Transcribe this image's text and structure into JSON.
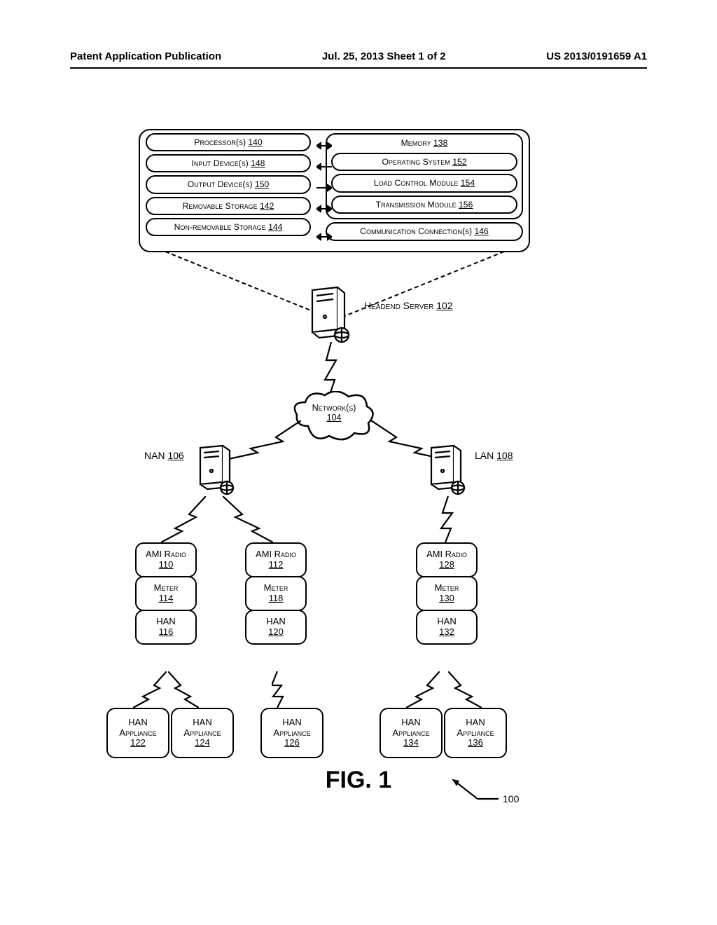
{
  "header": {
    "left": "Patent Application Publication",
    "center": "Jul. 25, 2013  Sheet 1 of 2",
    "right": "US 2013/0191659 A1"
  },
  "headend": {
    "processors": {
      "label": "Processor(s)",
      "ref": "140"
    },
    "input_devices": {
      "label": "Input Device(s)",
      "ref": "148"
    },
    "output_devices": {
      "label": "Output Device(s)",
      "ref": "150"
    },
    "removable_storage": {
      "label": "Removable Storage",
      "ref": "142"
    },
    "nonremovable_storage": {
      "label": "Non-removable Storage",
      "ref": "144"
    },
    "memory": {
      "label": "Memory",
      "ref": "138"
    },
    "os": {
      "label": "Operating System",
      "ref": "152"
    },
    "load_control": {
      "label": "Load Control Module",
      "ref": "154"
    },
    "transmission": {
      "label": "Transmission Module",
      "ref": "156"
    },
    "comm": {
      "label": "Communication Connection(s)",
      "ref": "146"
    }
  },
  "server_label": {
    "label": "Headend Server",
    "ref": "102"
  },
  "network": {
    "label": "Network(s)",
    "ref": "104"
  },
  "nan": {
    "label": "NAN",
    "ref": "106"
  },
  "lan": {
    "label": "LAN",
    "ref": "108"
  },
  "stacks": {
    "nan_left": {
      "ami": {
        "label": "AMI Radio",
        "ref": "110"
      },
      "meter": {
        "label": "Meter",
        "ref": "114"
      },
      "han": {
        "label": "HAN",
        "ref": "116"
      }
    },
    "nan_right": {
      "ami": {
        "label": "AMI Radio",
        "ref": "112"
      },
      "meter": {
        "label": "Meter",
        "ref": "118"
      },
      "han": {
        "label": "HAN",
        "ref": "120"
      }
    },
    "lan": {
      "ami": {
        "label": "AMI Radio",
        "ref": "128"
      },
      "meter": {
        "label": "Meter",
        "ref": "130"
      },
      "han": {
        "label": "HAN",
        "ref": "132"
      }
    }
  },
  "appliances": {
    "a122": {
      "label": "HAN Appliance",
      "ref": "122"
    },
    "a124": {
      "label": "HAN Appliance",
      "ref": "124"
    },
    "a126": {
      "label": "HAN Appliance",
      "ref": "126"
    },
    "a134": {
      "label": "HAN Appliance",
      "ref": "134"
    },
    "a136": {
      "label": "HAN Appliance",
      "ref": "136"
    }
  },
  "figure_title": "FIG. 1",
  "figure_ref": "100"
}
